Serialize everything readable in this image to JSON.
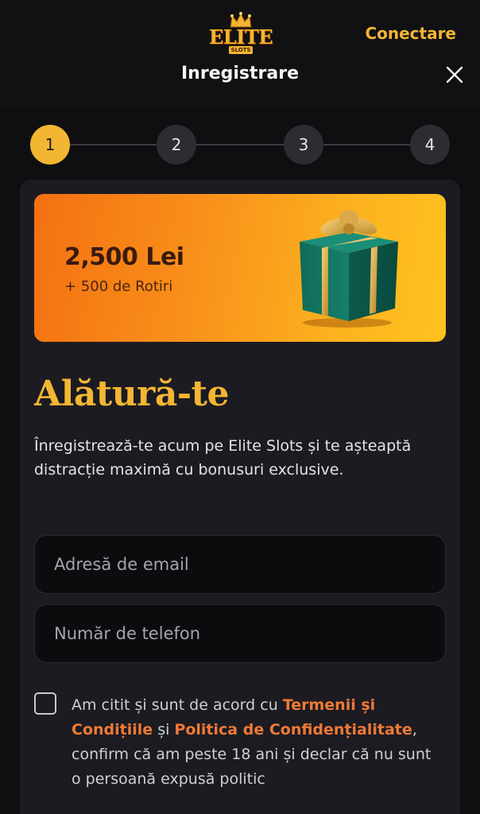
{
  "header": {
    "logo_text": "ELITE",
    "logo_sub": "SLOTS",
    "login_label": "Conectare",
    "title": "Inregistrare",
    "close_icon": "close-icon"
  },
  "stepper": {
    "current": 1,
    "steps": [
      "1",
      "2",
      "3",
      "4"
    ]
  },
  "bonus": {
    "amount": "2,500 Lei",
    "spins": "+ 500 de Rotiri",
    "gift_icon": "gift-box-icon"
  },
  "join": {
    "headline": "Alătură-te",
    "description": "Înregistrează-te acum pe Elite Slots și te așteaptă distracție maximă cu bonusuri exclusive."
  },
  "form": {
    "email_placeholder": "Adresă de email",
    "phone_placeholder": "Număr de telefon",
    "consent": {
      "checked": false,
      "text_before": "Am citit și sunt de acord cu ",
      "terms_link": "Termenii și Condițiile",
      "text_middle": " și ",
      "privacy_link": "Politica de Confidențialitate",
      "text_after": ", confirm că am peste 18 ani și declar că nu sunt o persoană expusă politic"
    }
  },
  "colors": {
    "accent": "#f2b632",
    "link": "#ef7a34",
    "background": "#0f0f12",
    "card": "#1c1b22"
  }
}
